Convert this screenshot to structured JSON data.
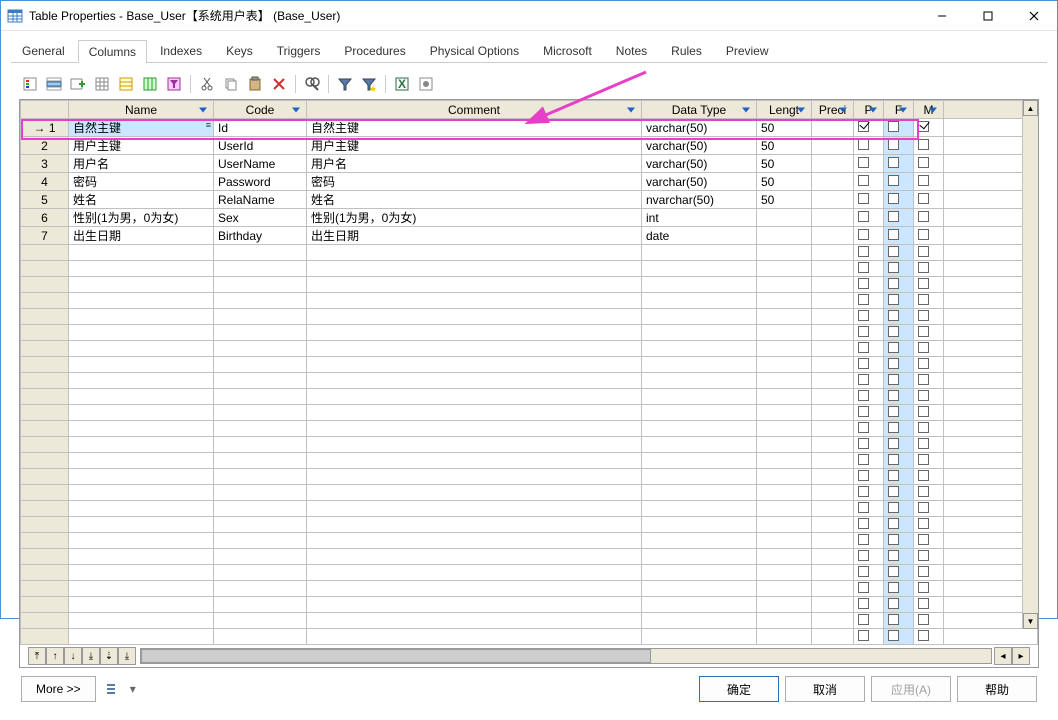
{
  "window": {
    "title": "Table Properties - Base_User【系统用户表】 (Base_User)"
  },
  "tabs": [
    "General",
    "Columns",
    "Indexes",
    "Keys",
    "Triggers",
    "Procedures",
    "Physical Options",
    "Microsoft",
    "Notes",
    "Rules",
    "Preview"
  ],
  "active_tab": 1,
  "columns": [
    {
      "key": "name",
      "label": "Name"
    },
    {
      "key": "code",
      "label": "Code"
    },
    {
      "key": "comment",
      "label": "Comment"
    },
    {
      "key": "datatype",
      "label": "Data Type"
    },
    {
      "key": "length",
      "label": "Lengt"
    },
    {
      "key": "precision",
      "label": "Preci"
    },
    {
      "key": "p",
      "label": "P"
    },
    {
      "key": "f",
      "label": "F"
    },
    {
      "key": "m",
      "label": "M"
    }
  ],
  "rows": [
    {
      "n": 1,
      "name": "自然主键",
      "code": "Id",
      "comment": "自然主键",
      "datatype": "varchar(50)",
      "length": "50",
      "precision": "",
      "p": true,
      "f": false,
      "m": true,
      "selected": true
    },
    {
      "n": 2,
      "name": "用户主键",
      "code": "UserId",
      "comment": "用户主键",
      "datatype": "varchar(50)",
      "length": "50",
      "precision": "",
      "p": false,
      "f": false,
      "m": false
    },
    {
      "n": 3,
      "name": "用户名",
      "code": "UserName",
      "comment": "用户名",
      "datatype": "varchar(50)",
      "length": "50",
      "precision": "",
      "p": false,
      "f": false,
      "m": false
    },
    {
      "n": 4,
      "name": "密码",
      "code": "Password",
      "comment": "密码",
      "datatype": "varchar(50)",
      "length": "50",
      "precision": "",
      "p": false,
      "f": false,
      "m": false
    },
    {
      "n": 5,
      "name": "姓名",
      "code": "RelaName",
      "comment": "姓名",
      "datatype": "nvarchar(50)",
      "length": "50",
      "precision": "",
      "p": false,
      "f": false,
      "m": false
    },
    {
      "n": 6,
      "name": "性别(1为男，0为女)",
      "code": "Sex",
      "comment": "性别(1为男，0为女)",
      "datatype": "int",
      "length": "",
      "precision": "",
      "p": false,
      "f": false,
      "m": false
    },
    {
      "n": 7,
      "name": "出生日期",
      "code": "Birthday",
      "comment": "出生日期",
      "datatype": "date",
      "length": "",
      "precision": "",
      "p": false,
      "f": false,
      "m": false
    }
  ],
  "empty_rows": 25,
  "footer": {
    "more": "More >>",
    "ok": "确定",
    "cancel": "取消",
    "apply": "应用(A)",
    "help": "帮助"
  },
  "toolbar_icons": [
    "properties",
    "insert-row",
    "add-row",
    "grid1",
    "grid2",
    "grid3",
    "filter",
    "cut",
    "copy",
    "paste",
    "delete",
    "find",
    "funnel",
    "funnel-star",
    "excel",
    "tools"
  ]
}
